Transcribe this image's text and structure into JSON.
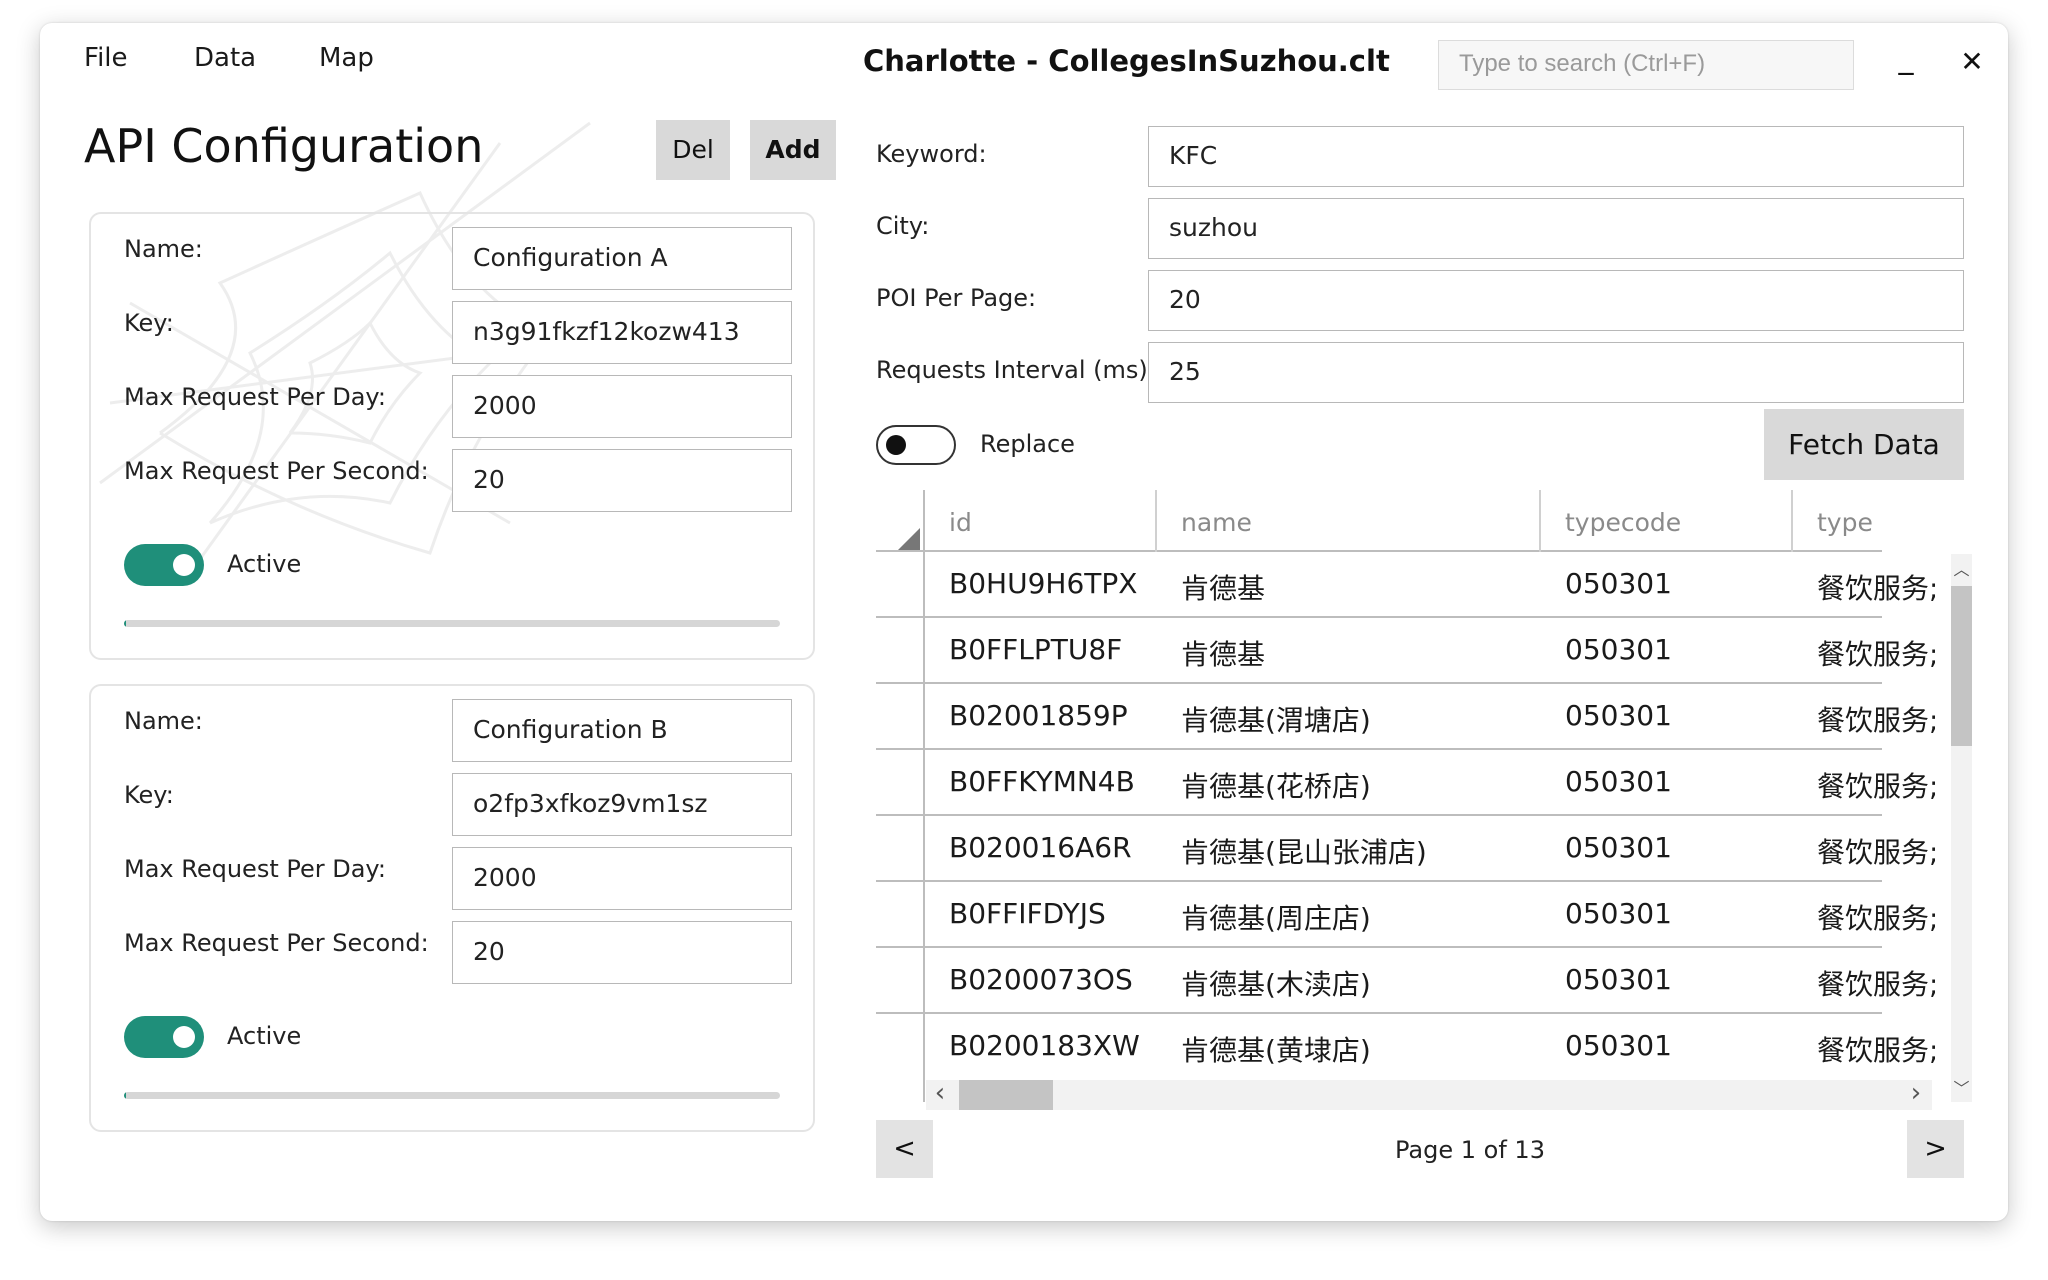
{
  "menu": {
    "items": [
      "File",
      "Data",
      "Map"
    ]
  },
  "window": {
    "title": "Charlotte - CollegesInSuzhou.clt",
    "search_placeholder": "Type to search (Ctrl+F)",
    "minimize_label": "_",
    "close_label": "✕"
  },
  "api_panel": {
    "title": "API Configuration",
    "del_label": "Del",
    "add_label": "Add",
    "labels": {
      "name": "Name:",
      "key": "Key:",
      "max_day": "Max Request Per Day:",
      "max_second": "Max Request Per Second:",
      "active": "Active"
    },
    "configs": [
      {
        "name": "Configuration A",
        "key": "n3g91fkzf12kozw413",
        "max_day": "2000",
        "max_second": "20",
        "active": true,
        "usage_fraction": 0.0
      },
      {
        "name": "Configuration B",
        "key": "o2fp3xfkoz9vm1sz",
        "max_day": "2000",
        "max_second": "20",
        "active": true,
        "usage_fraction": 0.0
      }
    ]
  },
  "query": {
    "keyword_label": "Keyword:",
    "keyword_value": "KFC",
    "city_label": "City:",
    "city_value": "suzhou",
    "poi_label": "POI Per Page:",
    "poi_value": "20",
    "interval_label": "Requests Interval (ms):",
    "interval_value": "25",
    "replace_label": "Replace",
    "replace_on": false,
    "fetch_label": "Fetch Data"
  },
  "grid": {
    "columns": [
      "id",
      "name",
      "typecode",
      "type"
    ],
    "rows": [
      [
        "B0HU9H6TPX",
        "肯德基",
        "050301",
        "餐饮服务;"
      ],
      [
        "B0FFLPTU8F",
        "肯德基",
        "050301",
        "餐饮服务;"
      ],
      [
        "B02001859P",
        "肯德基(渭塘店)",
        "050301",
        "餐饮服务;"
      ],
      [
        "B0FFKYMN4B",
        "肯德基(花桥店)",
        "050301",
        "餐饮服务;"
      ],
      [
        "B020016A6R",
        "肯德基(昆山张浦店)",
        "050301",
        "餐饮服务;"
      ],
      [
        "B0FFIFDYJS",
        "肯德基(周庄店)",
        "050301",
        "餐饮服务;"
      ],
      [
        "B0200073OS",
        "肯德基(木渎店)",
        "050301",
        "餐饮服务;"
      ],
      [
        "B0200183XW",
        "肯德基(黄埭店)",
        "050301",
        "餐饮服务;"
      ]
    ],
    "scroll_up": "︿",
    "scroll_down": "﹀",
    "scroll_left": "‹",
    "scroll_right": "›"
  },
  "pagination": {
    "prev_label": "<",
    "next_label": ">",
    "page_text": "Page 1 of 13"
  },
  "colors": {
    "accent": "#1f8f7a",
    "button_gray": "#d9d9d9",
    "border": "#b8b8b8"
  }
}
